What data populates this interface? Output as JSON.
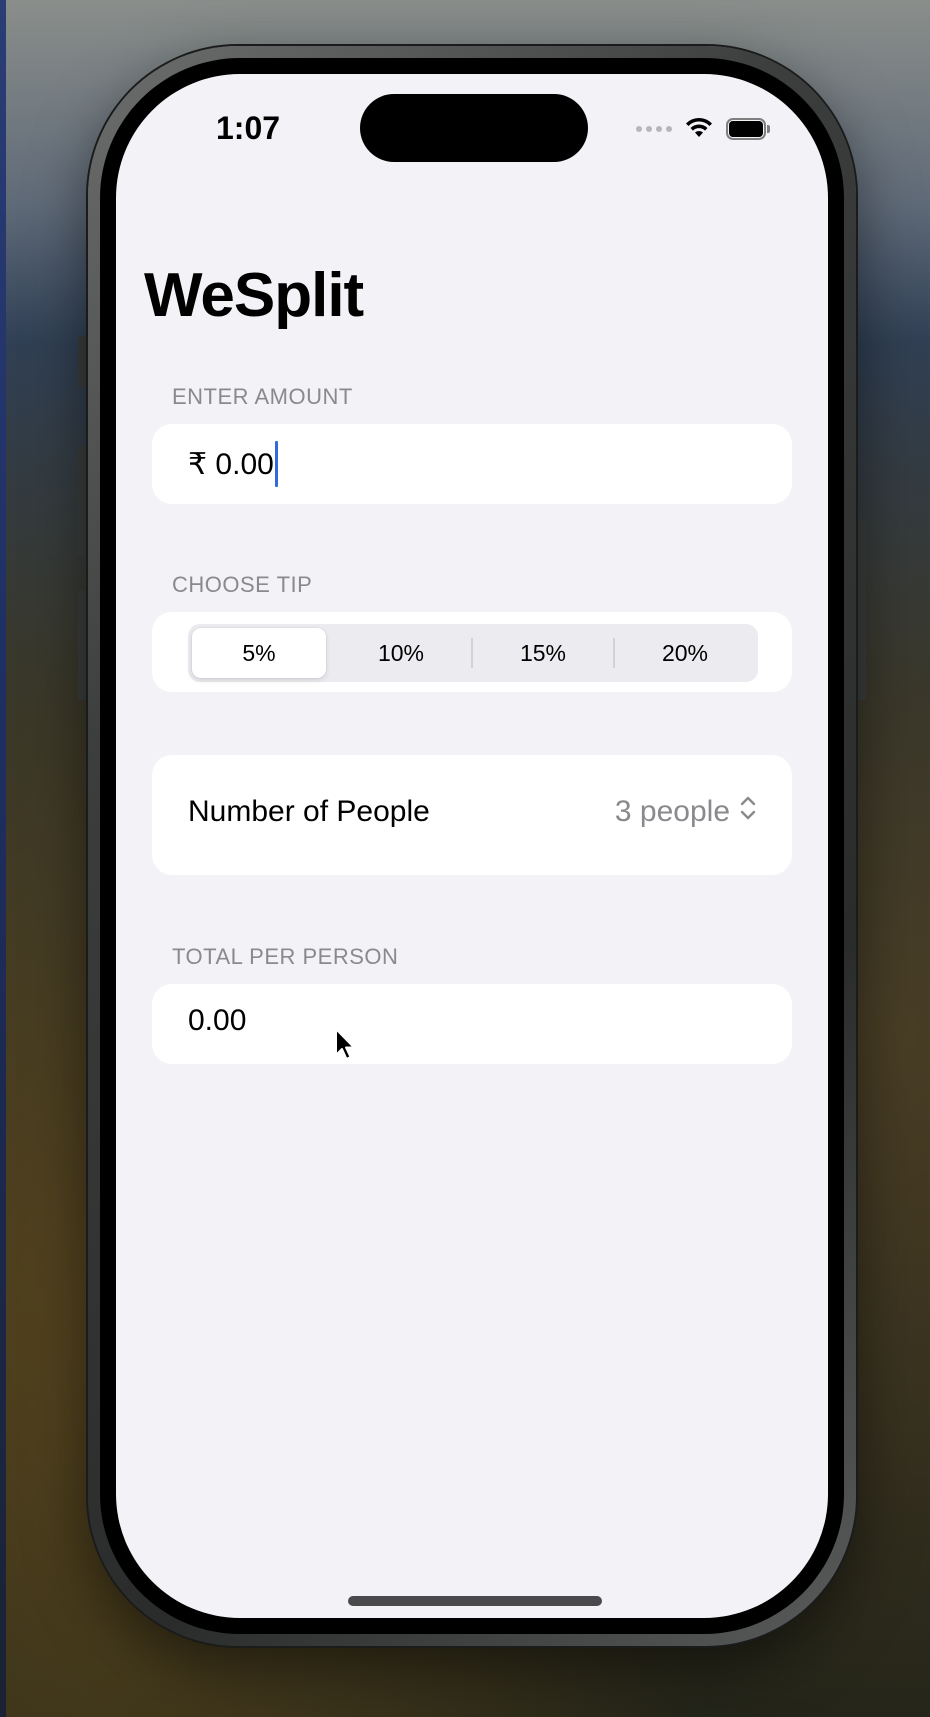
{
  "status_bar": {
    "time": "1:07"
  },
  "app": {
    "title": "WeSplit"
  },
  "amount_section": {
    "header": "ENTER AMOUNT",
    "value": "₹ 0.00"
  },
  "tip_section": {
    "header": "CHOOSE TIP",
    "options": [
      "5%",
      "10%",
      "15%",
      "20%"
    ],
    "selected_index": 0
  },
  "people_section": {
    "label": "Number of People",
    "value": "3 people"
  },
  "total_section": {
    "header": "TOTAL PER PERSON",
    "value": "0.00"
  },
  "colors": {
    "background": "#f2f2f7",
    "card": "#ffffff",
    "accent_caret": "#2f6bdc",
    "secondary_text": "#8a8a8e"
  },
  "icons": {
    "wifi": "wifi-icon",
    "battery": "battery-icon",
    "stepper": "chevron-up-down-icon",
    "pointer": "mouse-pointer-icon"
  }
}
